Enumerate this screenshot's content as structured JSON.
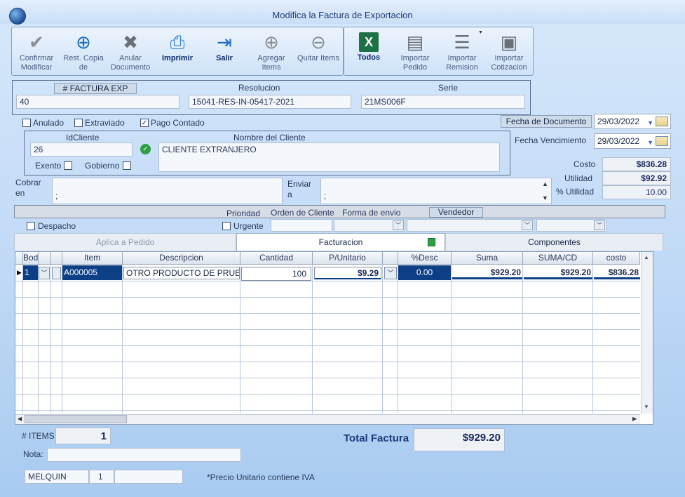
{
  "window": {
    "title": "Modifica la Factura de Exportacion"
  },
  "toolbar": {
    "confirmar": "Confirmar Modificar",
    "restcopia": "Rest. Copia de",
    "anular": "Anular Documento",
    "imprimir": "Imprimir",
    "salir": "Salir",
    "agregar": "Agregar Items",
    "quitar": "Quitar Items",
    "todos": "Todos",
    "imppedido": "Importar Pedido",
    "impremision": "Importar Remision",
    "impcotizacion": "Importar Cotizacion"
  },
  "factura": {
    "num_label": "# FACTURA EXP",
    "num": "40",
    "resolucion_label": "Resolucion",
    "resolucion": "15041-RES-IN-05417-2021",
    "serie_label": "Serie",
    "serie": "21MS006F"
  },
  "flags": {
    "anulado": "Anulado",
    "extraviado": "Extraviado",
    "pago_contado": "Pago Contado",
    "pago_check": "✓"
  },
  "fechas": {
    "doc_label": "Fecha de  Documento",
    "doc": "29/03/2022",
    "venc_label": "Fecha Vencimiento",
    "venc": "29/03/2022"
  },
  "cliente": {
    "id_label": "IdCliente",
    "id": "26",
    "nombre_label": "Nombre del Cliente",
    "nombre": "CLIENTE EXTRANJERO",
    "exento": "Exento",
    "gobierno": "Gobierno"
  },
  "totales_side": {
    "costo_label": "Costo",
    "costo": "$836.28",
    "utilidad_label": "Utilidad",
    "utilidad": "$92.92",
    "putil_label": "% Utilidad",
    "putil": "10.00"
  },
  "cobrar": {
    "label": "Cobrar en",
    "value": ";"
  },
  "enviar": {
    "label": "Enviar a",
    "value": ";"
  },
  "envio": {
    "prioridad": "Prioridad",
    "orden": "Orden de Cliente",
    "forma": "Forma de envio",
    "vendedor": "Vendedor",
    "despacho": "Despacho",
    "urgente": "Urgente"
  },
  "tabs": {
    "aplica": "Aplica a Pedido",
    "facturacion": "Facturacion",
    "componentes": "Componentes"
  },
  "grid": {
    "headers": [
      "Bodega",
      "",
      "Item",
      "Descripcion",
      "Cantidad",
      "P/Unitario",
      "",
      "%Desc",
      "Suma",
      "SUMA/CD",
      "costo"
    ],
    "row": {
      "bodega": "1",
      "item": "A000005",
      "descripcion": "OTRO PRODUCTO DE PRUEBA",
      "cantidad": "100",
      "punitario": "$9.29",
      "desc": "0.00",
      "suma": "$929.20",
      "sumacd": "$929.20",
      "costo": "$836.28"
    }
  },
  "footer": {
    "items_label": "# ITEMS",
    "items": "1",
    "total_label": "Total Factura",
    "total": "$929.20",
    "nota_label": "Nota:",
    "user": "MELQUIN",
    "user_num": "1",
    "note": "*Precio Unitario contiene IVA"
  }
}
